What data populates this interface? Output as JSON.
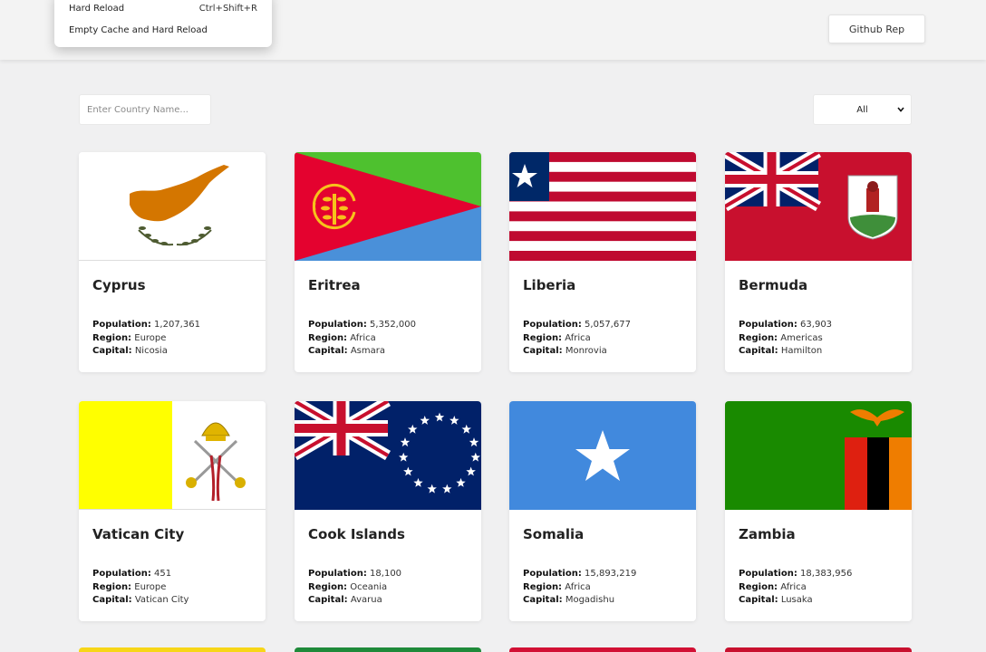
{
  "context_menu": {
    "items": [
      {
        "label": "Hard Reload",
        "shortcut": "Ctrl+Shift+R"
      },
      {
        "label": "Empty Cache and Hard Reload",
        "shortcut": ""
      }
    ]
  },
  "header": {
    "github_label": "Github Rep"
  },
  "controls": {
    "search_placeholder": "Enter Country Name...",
    "filter_value": "All"
  },
  "labels": {
    "population": "Population:",
    "region": "Region:",
    "capital": "Capital:"
  },
  "countries": [
    {
      "name": "Cyprus",
      "population": "1,207,361",
      "region": "Europe",
      "capital": "Nicosia"
    },
    {
      "name": "Eritrea",
      "population": "5,352,000",
      "region": "Africa",
      "capital": "Asmara"
    },
    {
      "name": "Liberia",
      "population": "5,057,677",
      "region": "Africa",
      "capital": "Monrovia"
    },
    {
      "name": "Bermuda",
      "population": "63,903",
      "region": "Americas",
      "capital": "Hamilton"
    },
    {
      "name": "Vatican City",
      "population": "451",
      "region": "Europe",
      "capital": "Vatican City"
    },
    {
      "name": "Cook Islands",
      "population": "18,100",
      "region": "Oceania",
      "capital": "Avarua"
    },
    {
      "name": "Somalia",
      "population": "15,893,219",
      "region": "Africa",
      "capital": "Mogadishu"
    },
    {
      "name": "Zambia",
      "population": "18,383,956",
      "region": "Africa",
      "capital": "Lusaka"
    }
  ],
  "colors": {
    "background": "#f0f0f1",
    "card": "#ffffff"
  }
}
